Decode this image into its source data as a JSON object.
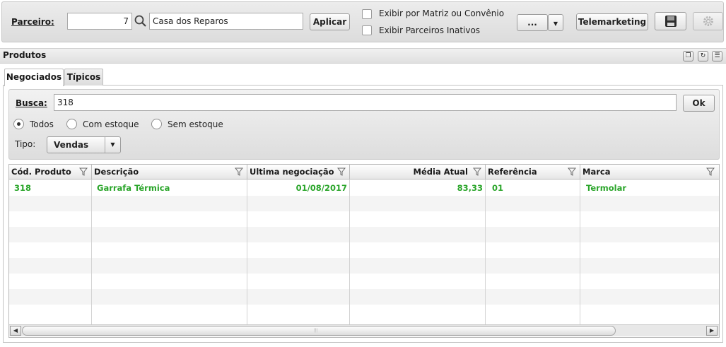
{
  "toolbar": {
    "parceiro_label": "Parceiro:",
    "parceiro_code": "7",
    "parceiro_name": "Casa dos Reparos",
    "apply_label": "Aplicar",
    "check_matriz": "Exibir por Matriz ou Convênio",
    "check_inativos": "Exibir Parceiros Inativos",
    "more_label": "...",
    "telemarketing_label": "Telemarketing"
  },
  "section": {
    "title": "Produtos"
  },
  "tabs": [
    {
      "label": "Negociados",
      "active": true
    },
    {
      "label": "Típicos",
      "active": false
    }
  ],
  "search": {
    "label": "Busca:",
    "value": "318",
    "ok_label": "Ok",
    "radios": [
      {
        "label": "Todos",
        "checked": true
      },
      {
        "label": "Com estoque",
        "checked": false
      },
      {
        "label": "Sem estoque",
        "checked": false
      }
    ],
    "tipo_label": "Tipo:",
    "tipo_value": "Vendas"
  },
  "grid": {
    "columns": [
      "Cód. Produto",
      "Descrição",
      "Ultima negociação",
      "Média Atual",
      "Referência",
      "Marca"
    ],
    "rows": [
      {
        "codigo": "318",
        "descricao": "Garrafa Térmica",
        "ultima": "01/08/2017",
        "media": "83,33",
        "referencia": "01",
        "marca": "Termolar"
      }
    ]
  },
  "colors": {
    "row_text": "#2aa52a"
  }
}
